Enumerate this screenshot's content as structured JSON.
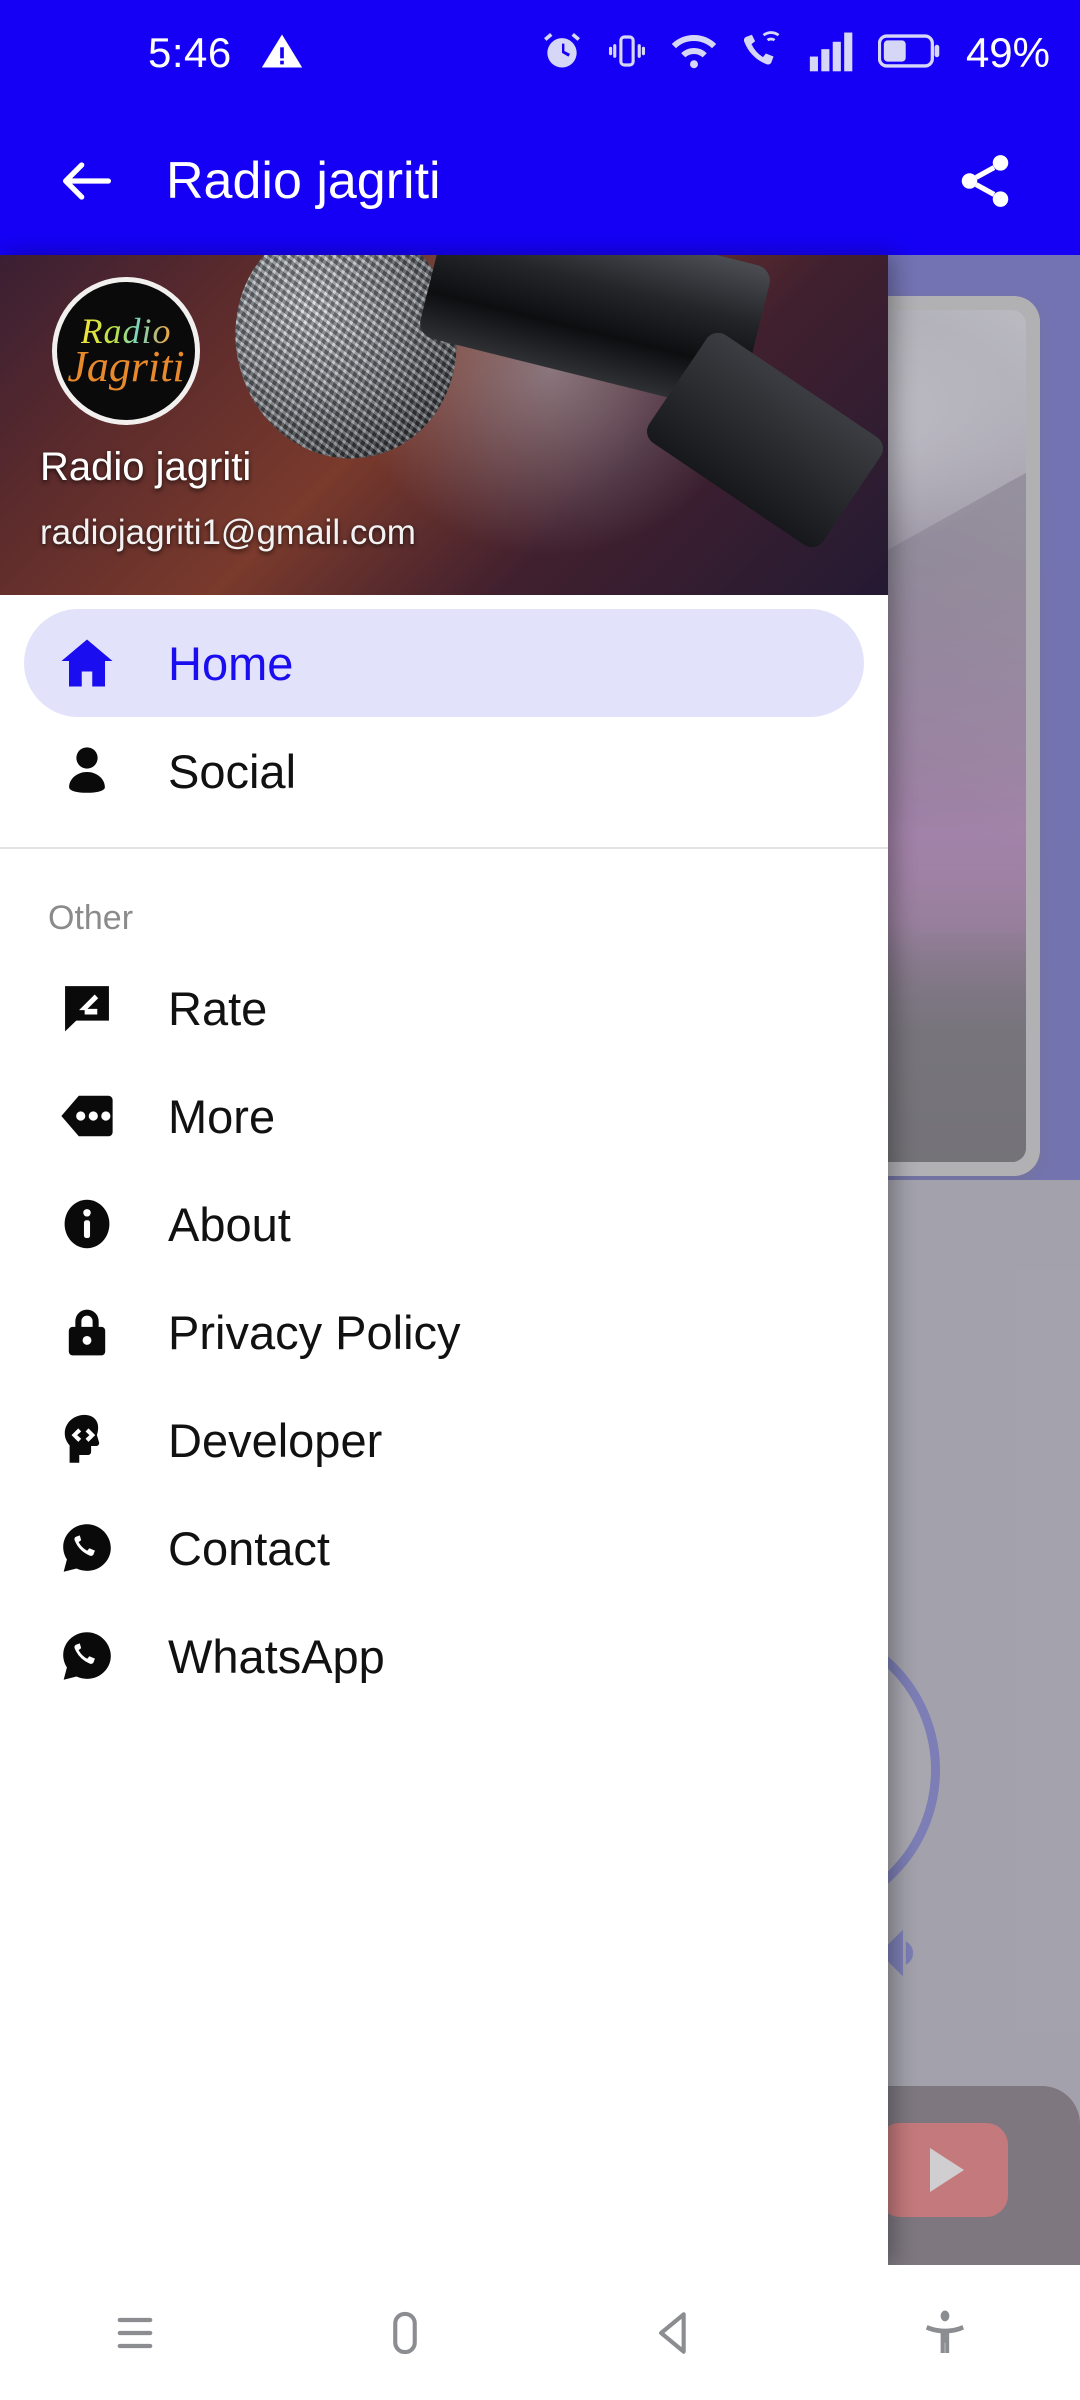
{
  "status_bar": {
    "time": "5:46",
    "battery_percent": "49%",
    "icons": [
      "warning-triangle-icon",
      "alarm-clock-icon",
      "vibrate-icon",
      "wifi-icon",
      "wifi-calling-icon",
      "signal-bars-icon",
      "battery-icon"
    ]
  },
  "app_bar": {
    "back_label": "back-arrow-icon",
    "title": "Radio jagriti",
    "share_label": "share-icon",
    "background_color": "#1500f5"
  },
  "drawer": {
    "header": {
      "logo_line1": "Radio",
      "logo_line2": "Jagriti",
      "name": "Radio jagriti",
      "email": "radiojagriti1@gmail.com"
    },
    "primary_items": [
      {
        "label": "Home",
        "icon": "home-icon",
        "selected": true
      },
      {
        "label": "Social",
        "icon": "person-icon",
        "selected": false
      }
    ],
    "section_label": "Other",
    "other_items": [
      {
        "label": "Rate",
        "icon": "rate-review-icon"
      },
      {
        "label": "More",
        "icon": "more-horiz-icon"
      },
      {
        "label": "About",
        "icon": "info-icon"
      },
      {
        "label": "Privacy Policy",
        "icon": "lock-icon"
      },
      {
        "label": "Developer",
        "icon": "developer-head-code-icon"
      },
      {
        "label": "Contact",
        "icon": "whatsapp-icon"
      },
      {
        "label": "WhatsApp",
        "icon": "whatsapp-icon"
      }
    ],
    "selected_color": "#1a0df0",
    "selected_pill_color": "#e2e2fb"
  },
  "bottom_nav": {
    "items": [
      {
        "name": "recent-apps-icon"
      },
      {
        "name": "home-button-icon"
      },
      {
        "name": "back-button-icon"
      },
      {
        "name": "accessibility-icon"
      }
    ]
  }
}
